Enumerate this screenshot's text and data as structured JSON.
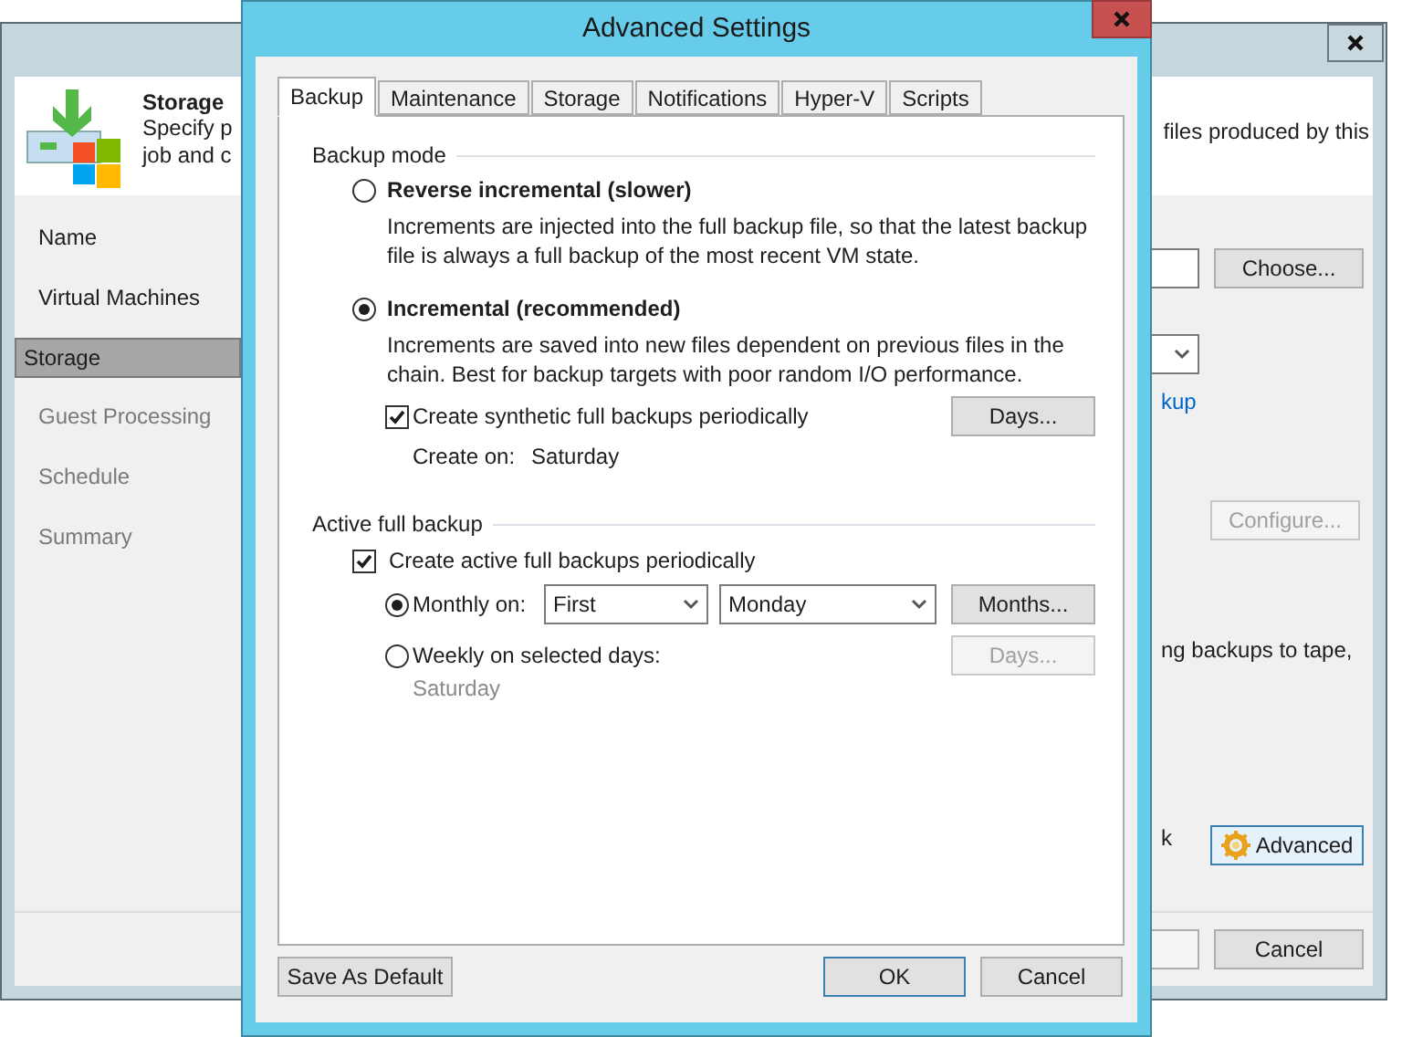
{
  "background_window": {
    "header": {
      "title": "Storage",
      "description_lines": [
        "Specify p",
        "job and c"
      ],
      "description_right": "files produced by this"
    },
    "steps": [
      {
        "label": "Name",
        "selected": false,
        "disabled": false
      },
      {
        "label": "Virtual Machines",
        "selected": false,
        "disabled": false
      },
      {
        "label": "Storage",
        "selected": true,
        "disabled": false
      },
      {
        "label": "Guest Processing",
        "selected": false,
        "disabled": true
      },
      {
        "label": "Schedule",
        "selected": false,
        "disabled": true
      },
      {
        "label": "Summary",
        "selected": false,
        "disabled": true
      }
    ],
    "right_panel": {
      "choose_button": "Choose...",
      "link_fragment": "kup",
      "configure_button": {
        "label": "Configure...",
        "disabled": true
      },
      "tape_text": "ng backups to tape,",
      "text_fragment": "k",
      "advanced_button": "Advanced"
    },
    "footer": {
      "cancel_button": "Cancel"
    }
  },
  "dialog": {
    "title": "Advanced Settings",
    "tabs": [
      {
        "label": "Backup",
        "selected": true
      },
      {
        "label": "Maintenance",
        "selected": false
      },
      {
        "label": "Storage",
        "selected": false
      },
      {
        "label": "Notifications",
        "selected": false
      },
      {
        "label": "Hyper-V",
        "selected": false
      },
      {
        "label": "Scripts",
        "selected": false
      }
    ],
    "backup_mode": {
      "title": "Backup mode",
      "options": [
        {
          "label": "Reverse incremental (slower)",
          "selected": false,
          "description_lines": [
            "Increments are injected into the full backup file, so that the latest backup",
            "file is always a full backup of the most recent VM state."
          ]
        },
        {
          "label": "Incremental (recommended)",
          "selected": true,
          "description_lines": [
            "Increments are saved into new files dependent on previous files in the",
            "chain. Best for backup targets with poor random I/O performance."
          ]
        }
      ],
      "synthetic": {
        "label": "Create synthetic full backups periodically",
        "checked": true,
        "button": "Days...",
        "create_on_label": "Create on:",
        "create_on_day": "Saturday"
      }
    },
    "active_full": {
      "title": "Active full backup",
      "checkbox": {
        "label": "Create active full backups periodically",
        "checked": true
      },
      "monthly": {
        "label": "Monthly on:",
        "selected": true,
        "week": "First",
        "day": "Monday",
        "button": "Months..."
      },
      "weekly": {
        "label": "Weekly on selected days:",
        "selected": false,
        "button": {
          "label": "Days...",
          "disabled": true
        },
        "days": "Saturday"
      }
    },
    "buttons": {
      "save_default": "Save As Default",
      "ok": "OK",
      "cancel": "Cancel"
    }
  }
}
